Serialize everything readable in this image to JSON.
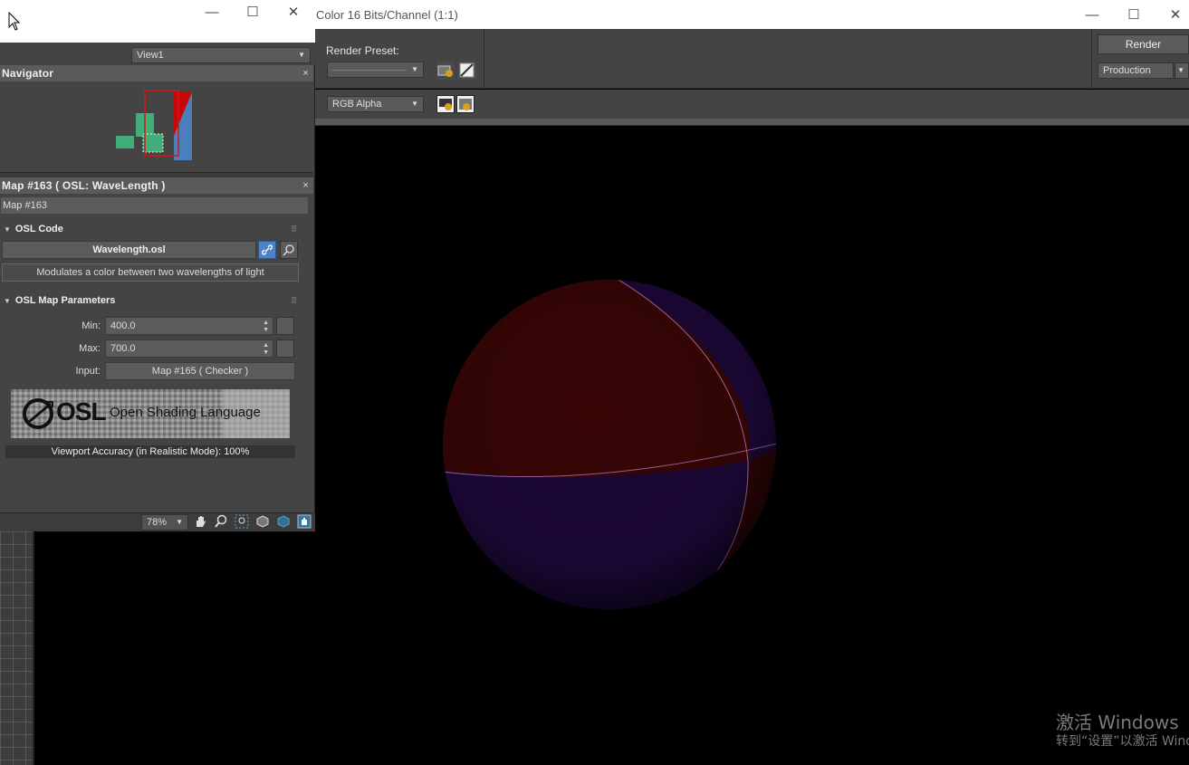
{
  "render_window": {
    "title": "Color 16 Bits/Channel (1:1)",
    "window_controls": {
      "minimize": "—",
      "maximize": "☐",
      "close": "✕"
    },
    "render_preset_label": "Render Preset:",
    "render_preset_value": "",
    "channel_dropdown": "RGB Alpha",
    "render_button": "Render",
    "production_dropdown": "Production"
  },
  "slate_editor": {
    "window_controls": {
      "minimize": "—",
      "maximize": "☐",
      "close": "✕"
    },
    "view_dropdown": "View1",
    "navigator": {
      "title": "Navigator",
      "close": "×"
    },
    "param_panel": {
      "title": "Map #163  ( OSL: WaveLength )",
      "close": "×",
      "map_name": "Map #163"
    },
    "osl_code": {
      "rollout_title": "OSL Code",
      "file_name": "Wavelength.osl",
      "description": "Modulates a color between two wavelengths of light"
    },
    "osl_params": {
      "rollout_title": "OSL Map Parameters",
      "min_label": "Min:",
      "min_value": "400.0",
      "max_label": "Max:",
      "max_value": "700.0",
      "input_label": "Input:",
      "input_value": "Map #165  ( Checker )"
    },
    "logo": {
      "wordmark": "OSL",
      "tagline": "Open Shading Language"
    },
    "viewport_accuracy": "Viewport Accuracy (in Realistic Mode): 100%",
    "zoom": "78%"
  },
  "watermark": {
    "title": "激活 Windows",
    "subtitle": "转到“设置”以激活 Windows。"
  },
  "colors": {
    "panel_bg": "#444444",
    "header_bg": "#5a5a5a",
    "sphere_red": "#3a0606",
    "sphere_blue": "#1c0838",
    "accent_link": "#4b82c8"
  }
}
